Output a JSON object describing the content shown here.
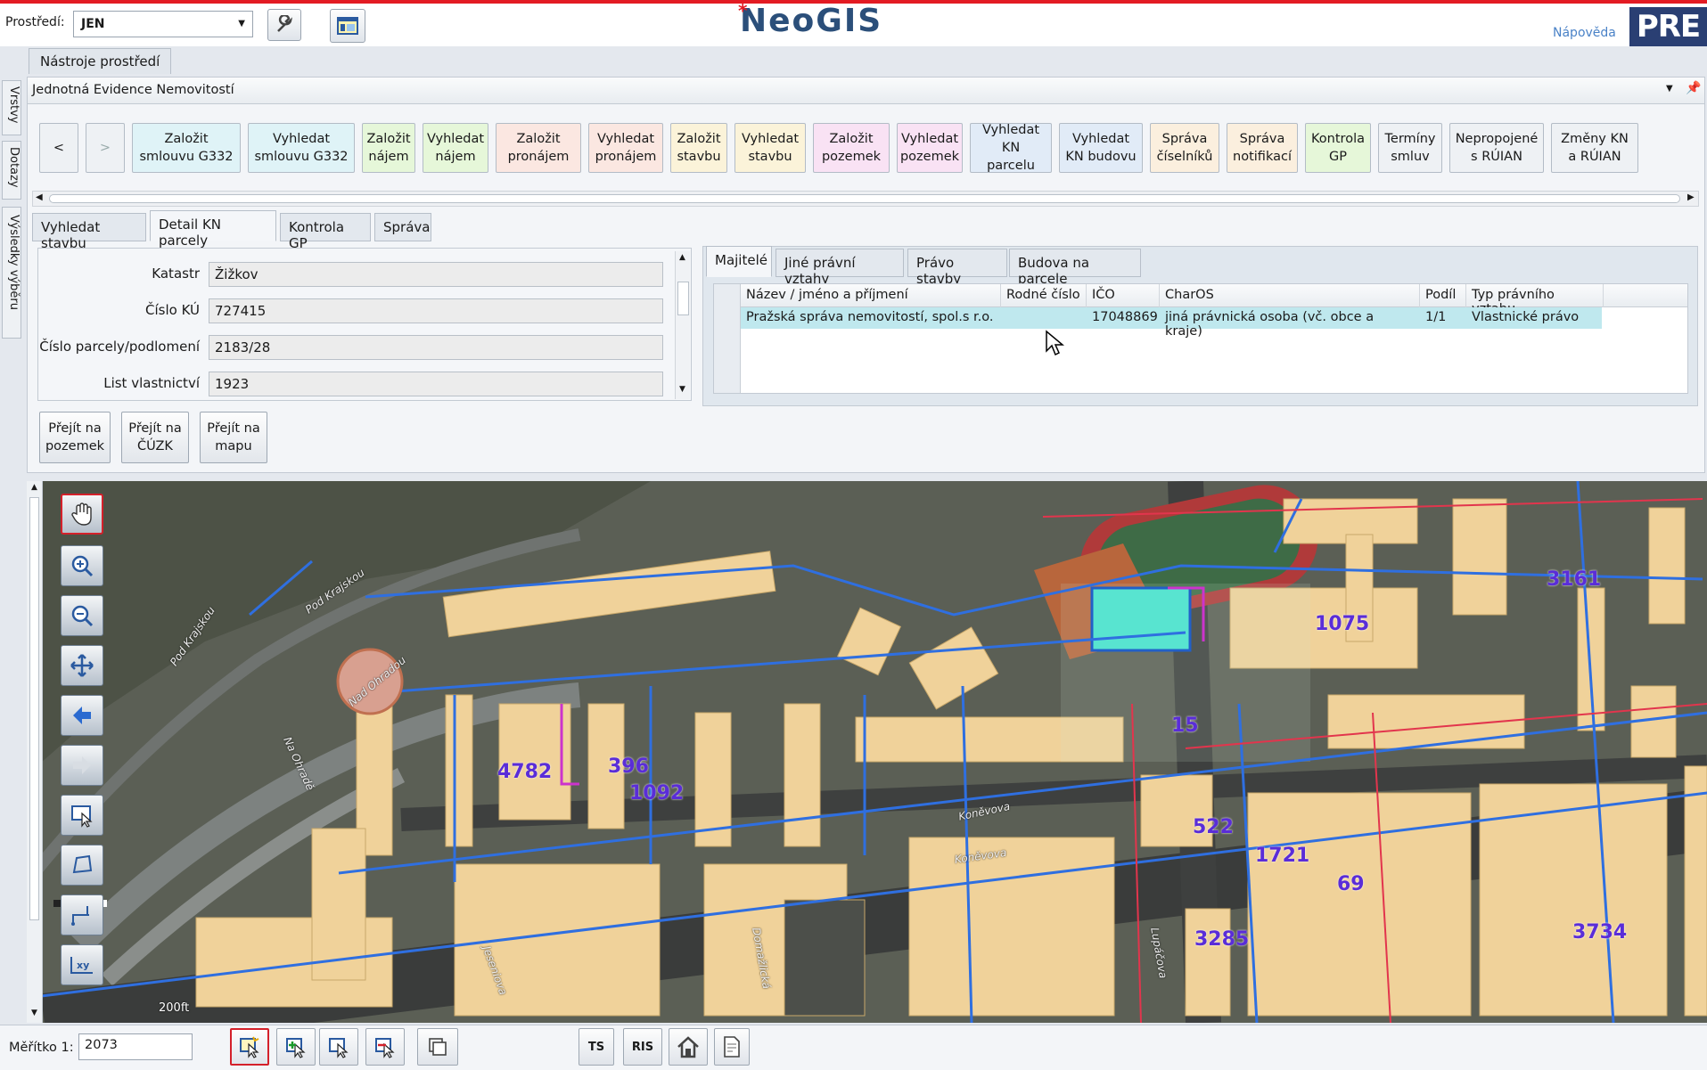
{
  "top": {
    "env_label": "Prostředí:",
    "env_value": "JEN",
    "app_title": "NeoGIS",
    "help_link": "Nápověda",
    "brand": "PRE"
  },
  "tools_tab": "Nástroje prostředí",
  "side_tabs": [
    "Vrstvy",
    "Dotazy",
    "Výsledky výběru"
  ],
  "module_title": "Jednotná Evidence Nemovitostí",
  "nav": {
    "back": "<",
    "forward": ">"
  },
  "quick_buttons": [
    {
      "l1": "Založit",
      "l2": "smlouvu G332",
      "color": "#dff3f7"
    },
    {
      "l1": "Vyhledat",
      "l2": "smlouvu G332",
      "color": "#dff3f7"
    },
    {
      "l1": "Založit",
      "l2": "nájem",
      "color": "#e6f7d9"
    },
    {
      "l1": "Vyhledat",
      "l2": "nájem",
      "color": "#e6f7d9"
    },
    {
      "l1": "Založit",
      "l2": "pronájem",
      "color": "#fbe7e1"
    },
    {
      "l1": "Vyhledat",
      "l2": "pronájem",
      "color": "#fbe7e1"
    },
    {
      "l1": "Založit",
      "l2": "stavbu",
      "color": "#fbf3d9"
    },
    {
      "l1": "Vyhledat",
      "l2": "stavbu",
      "color": "#fbf3d9"
    },
    {
      "l1": "Založit",
      "l2": "pozemek",
      "color": "#f9e2f4"
    },
    {
      "l1": "Vyhledat",
      "l2": "pozemek",
      "color": "#f9e2f4"
    },
    {
      "l1": "Vyhledat",
      "l2": "KN parcelu",
      "color": "#e1ebf7"
    },
    {
      "l1": "Vyhledat",
      "l2": "KN budovu",
      "color": "#e1ebf7"
    },
    {
      "l1": "Správa",
      "l2": "číselníků",
      "color": "#fbefde"
    },
    {
      "l1": "Správa",
      "l2": "notifikací",
      "color": "#fbefde"
    },
    {
      "l1": "Kontrola",
      "l2": "GP",
      "color": "#e6f7d9"
    },
    {
      "l1": "Termíny",
      "l2": "smluv",
      "color": "#eef1f4"
    },
    {
      "l1": "Nepropojené",
      "l2": "s RÚIAN",
      "color": "#eef1f4"
    },
    {
      "l1": "Změny KN",
      "l2": "a RÚIAN",
      "color": "#eef1f4"
    }
  ],
  "detail_tabs": [
    "Vyhledat stavbu",
    "Detail KN parcely",
    "Kontrola GP",
    "Správa"
  ],
  "fields": [
    {
      "label": "Katastr",
      "value": "Žižkov"
    },
    {
      "label": "Číslo KÚ",
      "value": "727415"
    },
    {
      "label": "Číslo parcely/podlomení",
      "value": "2183/28"
    },
    {
      "label": "List vlastnictví",
      "value": "1923"
    }
  ],
  "actions": [
    {
      "l1": "Přejít na",
      "l2": "pozemek"
    },
    {
      "l1": "Přejít na",
      "l2": "ČÚZK"
    },
    {
      "l1": "Přejít na",
      "l2": "mapu"
    }
  ],
  "owner_tabs": [
    "Majitelé",
    "Jiné právní vztahy",
    "Právo stavby",
    "Budova na parcele"
  ],
  "owners": {
    "columns": [
      "Název / jméno a příjmení",
      "Rodné číslo",
      "IČO",
      "CharOS",
      "Podíl",
      "Typ právního vztahu"
    ],
    "rows": [
      [
        "Pražská správa nemovitostí, spol.s r.o.",
        "",
        "17048869",
        "jiná právnická osoba (vč. obce a kraje)",
        "1/1",
        "Vlastnické právo"
      ]
    ]
  },
  "map": {
    "parcel_numbers": [
      "3161",
      "1075",
      "15",
      "4782",
      "396",
      "1092",
      "522",
      "1721",
      "69",
      "3285",
      "3734"
    ],
    "streets": [
      "Pod Krajskou",
      "Pod Krajskou",
      "Nad Ohradou",
      "Na Ohradě",
      "Koněvova",
      "Koněvova",
      "Jeseniova",
      "Lupáčova",
      "Domažlická"
    ],
    "scale_bar": "200ft"
  },
  "bottom": {
    "scale_label": "Měřítko 1:",
    "scale_value": "2073",
    "ts": "TS",
    "ris": "RIS"
  }
}
